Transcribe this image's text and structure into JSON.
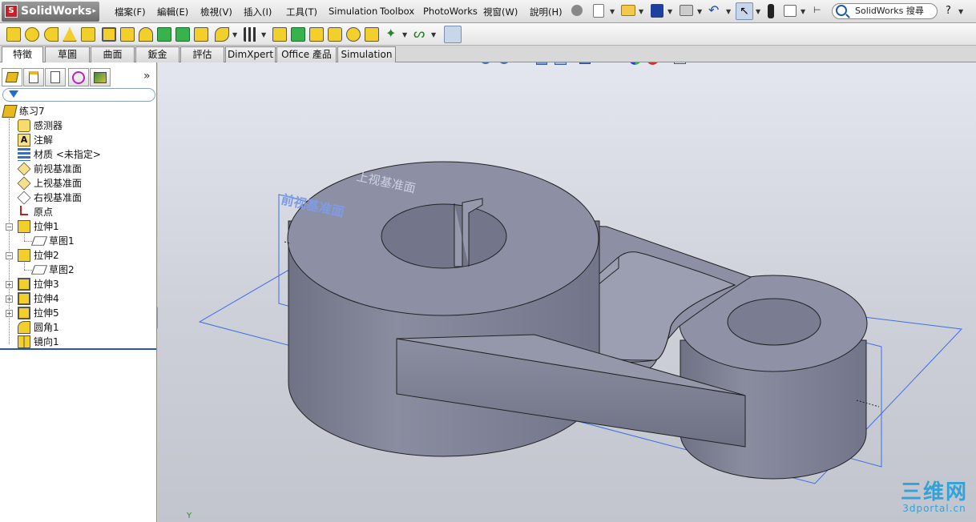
{
  "app": {
    "logo_text": "SolidWorks",
    "logo_mark": "S"
  },
  "menu": {
    "items": [
      "檔案(F)",
      "編輯(E)",
      "檢視(V)",
      "插入(I)",
      "工具(T)",
      "Simulation",
      "Toolbox",
      "PhotoWorks",
      "視窗(W)",
      "說明(H)"
    ]
  },
  "search": {
    "placeholder": "SolidWorks 搜尋"
  },
  "help_label": "?",
  "command_tabs": [
    "特徵",
    "草圖",
    "曲面",
    "鈑金",
    "評估",
    "DimXpert",
    "Office 產品",
    "Simulation"
  ],
  "feature_tree": {
    "root": "练习7",
    "nodes": [
      {
        "label": "感测器",
        "icon": "sensor-icon"
      },
      {
        "label": "注解",
        "icon": "annotation-icon"
      },
      {
        "label": "材质 <未指定>",
        "icon": "material-icon"
      },
      {
        "label": "前视基准面",
        "icon": "plane-icon"
      },
      {
        "label": "上视基准面",
        "icon": "plane-icon"
      },
      {
        "label": "右视基准面",
        "icon": "plane-icon"
      },
      {
        "label": "原点",
        "icon": "origin-icon"
      },
      {
        "label": "拉伸1",
        "icon": "extrude-icon"
      },
      {
        "label": "草图1",
        "icon": "sketch-icon"
      },
      {
        "label": "拉伸2",
        "icon": "extrude-icon"
      },
      {
        "label": "草图2",
        "icon": "sketch-icon"
      },
      {
        "label": "拉伸3",
        "icon": "extrude-icon"
      },
      {
        "label": "拉伸4",
        "icon": "extrude-icon"
      },
      {
        "label": "拉伸5",
        "icon": "extrude-icon"
      },
      {
        "label": "圆角1",
        "icon": "fillet-icon"
      },
      {
        "label": "镜向1",
        "icon": "mirror-icon"
      }
    ]
  },
  "viewport": {
    "plane_labels": [
      "上视基准面",
      "前视基准面"
    ],
    "axis_label": "Y"
  },
  "watermark": {
    "main": "三维网",
    "site": "3dportal.cn"
  },
  "colors": {
    "part_body": "#7d8096",
    "plane_outline": "#3f6fe0",
    "watermark": "#31a3d8"
  },
  "expand_chevron": "»"
}
